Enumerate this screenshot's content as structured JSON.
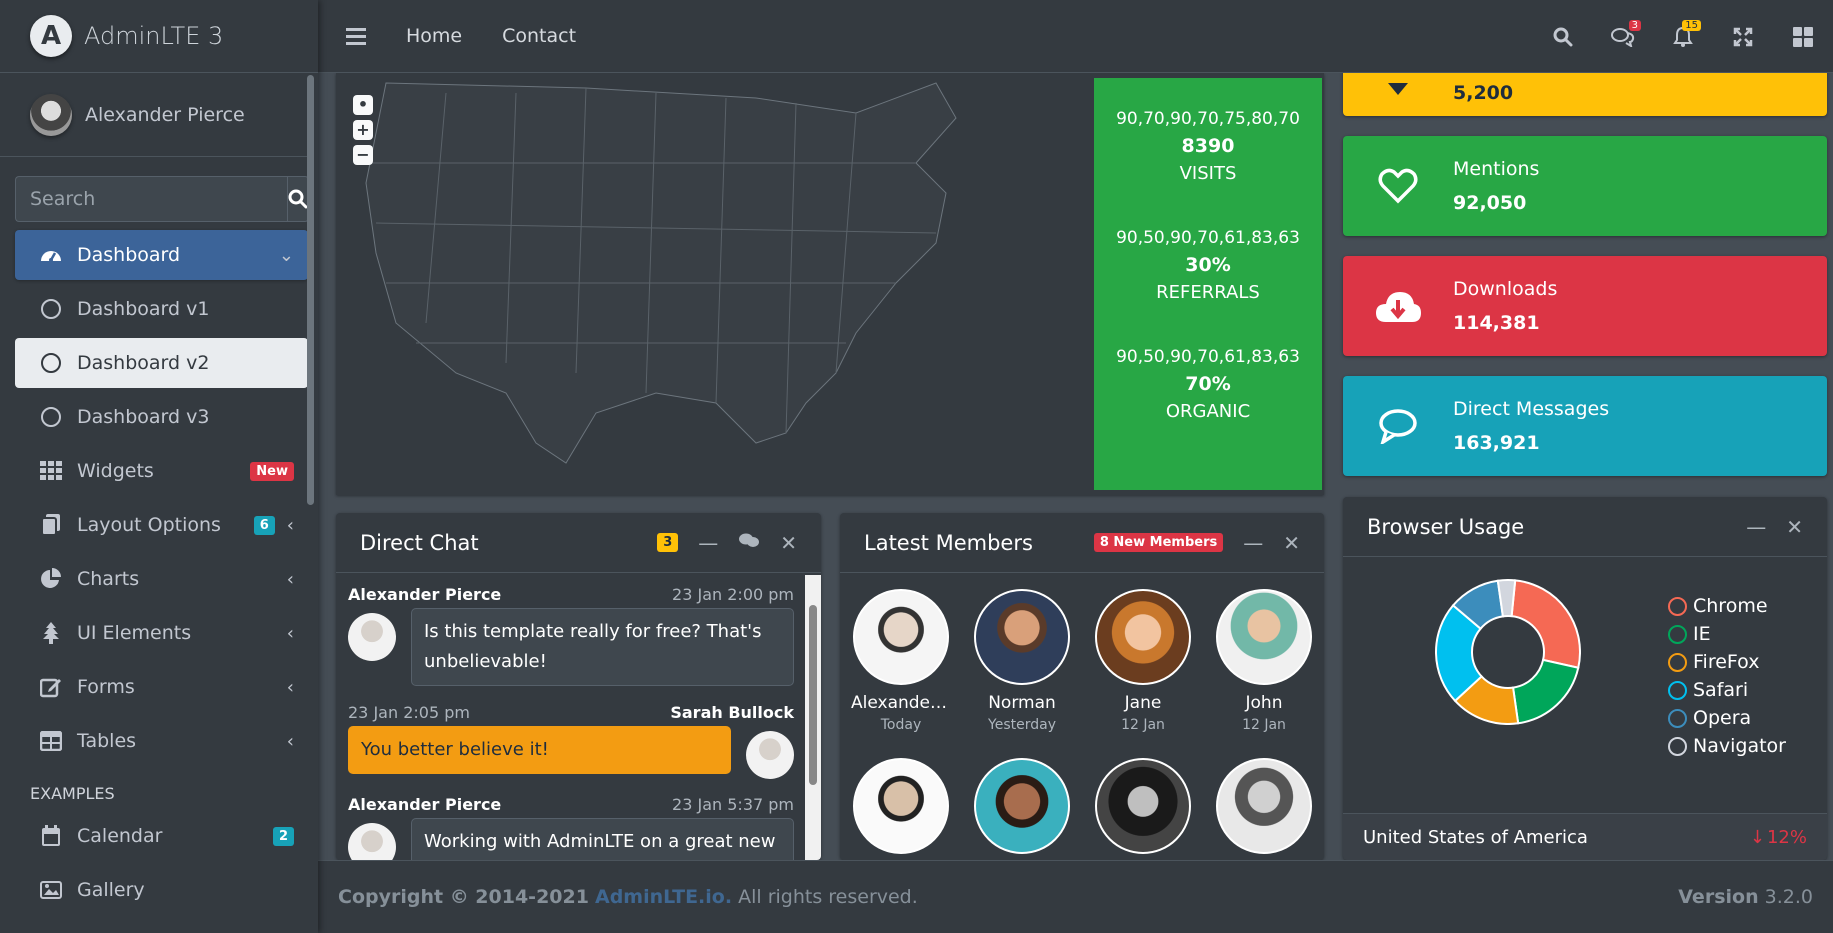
{
  "brand": {
    "name": "AdminLTE 3",
    "logo_letter": "A"
  },
  "user": {
    "name": "Alexander Pierce"
  },
  "search": {
    "placeholder": "Search"
  },
  "sidebar": {
    "items": [
      {
        "label": "Dashboard"
      },
      {
        "label": "Dashboard v1"
      },
      {
        "label": "Dashboard v2"
      },
      {
        "label": "Dashboard v3"
      },
      {
        "label": "Widgets",
        "badge": "New"
      },
      {
        "label": "Layout Options",
        "badge": "6"
      },
      {
        "label": "Charts"
      },
      {
        "label": "UI Elements"
      },
      {
        "label": "Forms"
      },
      {
        "label": "Tables"
      }
    ],
    "header": "EXAMPLES",
    "examples": [
      {
        "label": "Calendar",
        "badge": "2"
      },
      {
        "label": "Gallery"
      }
    ]
  },
  "topnav": {
    "links": [
      "Home",
      "Contact"
    ],
    "messages_badge": "3",
    "notifications_badge": "15"
  },
  "map_stats": [
    {
      "spark": "90,70,90,70,75,80,70",
      "value": "8390",
      "label": "VISITS"
    },
    {
      "spark": "90,50,90,70,61,83,63",
      "value": "30%",
      "label": "REFERRALS"
    },
    {
      "spark": "90,50,90,70,61,83,63",
      "value": "70%",
      "label": "ORGANIC"
    }
  ],
  "info_boxes": [
    {
      "label": "",
      "value": "5,200",
      "color": "#ffc107"
    },
    {
      "label": "Mentions",
      "value": "92,050",
      "color": "#28a745"
    },
    {
      "label": "Downloads",
      "value": "114,381",
      "color": "#dc3545"
    },
    {
      "label": "Direct Messages",
      "value": "163,921",
      "color": "#17a2b8"
    }
  ],
  "direct_chat": {
    "title": "Direct Chat",
    "badge": "3",
    "messages": [
      {
        "name": "Alexander Pierce",
        "time": "23 Jan 2:00 pm",
        "text": "Is this template really for free? That's unbelievable!"
      },
      {
        "name": "Sarah Bullock",
        "time": "23 Jan 2:05 pm",
        "text": "You better believe it!"
      },
      {
        "name": "Alexander Pierce",
        "time": "23 Jan 5:37 pm",
        "text": "Working with AdminLTE on a great new"
      }
    ]
  },
  "latest_members": {
    "title": "Latest Members",
    "badge": "8 New Members",
    "members": [
      {
        "name": "Alexander ...",
        "date": "Today"
      },
      {
        "name": "Norman",
        "date": "Yesterday"
      },
      {
        "name": "Jane",
        "date": "12 Jan"
      },
      {
        "name": "John",
        "date": "12 Jan"
      }
    ]
  },
  "browser_usage": {
    "title": "Browser Usage",
    "footer_country": "United States of America",
    "footer_change": "12%",
    "legend": [
      {
        "name": "Chrome",
        "color": "#f56954"
      },
      {
        "name": "IE",
        "color": "#00a65a"
      },
      {
        "name": "FireFox",
        "color": "#f39c12"
      },
      {
        "name": "Safari",
        "color": "#00c0ef"
      },
      {
        "name": "Opera",
        "color": "#3c8dbc"
      },
      {
        "name": "Navigator",
        "color": "#d2d6de"
      }
    ]
  },
  "chart_data": {
    "type": "pie",
    "categories": [
      "Chrome",
      "IE",
      "FireFox",
      "Safari",
      "Opera",
      "Navigator"
    ],
    "values": [
      700,
      500,
      400,
      600,
      300,
      100
    ]
  },
  "footer": {
    "copyright": "Copyright © 2014-2021",
    "link": "AdminLTE.io.",
    "rights": "All rights reserved.",
    "version_label": "Version",
    "version": "3.2.0"
  }
}
